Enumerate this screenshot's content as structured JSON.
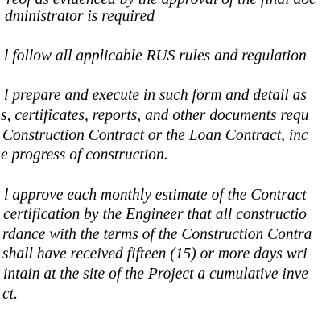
{
  "document": {
    "paragraphs": [
      {
        "lines": [
          "reof as evidenced by the approval of the final doc",
          "dministrator is required"
        ]
      },
      {
        "lines": [
          "l follow all applicable RUS rules and regulation"
        ]
      },
      {
        "lines": [
          "l prepare and execute in such form and detail as",
          "s, certificates, reports, and other documents requ",
          "Construction Contract or the Loan Contract, inc",
          "e progress of construction."
        ]
      },
      {
        "lines": [
          "l approve each monthly estimate of the Contract",
          "certification by the Engineer that all constructio",
          "rdance with the terms of the Construction Contra",
          "shall have received fifteen (15) or more days wri",
          "intain at the site of the Project a cumulative inve",
          "ct."
        ]
      }
    ]
  }
}
